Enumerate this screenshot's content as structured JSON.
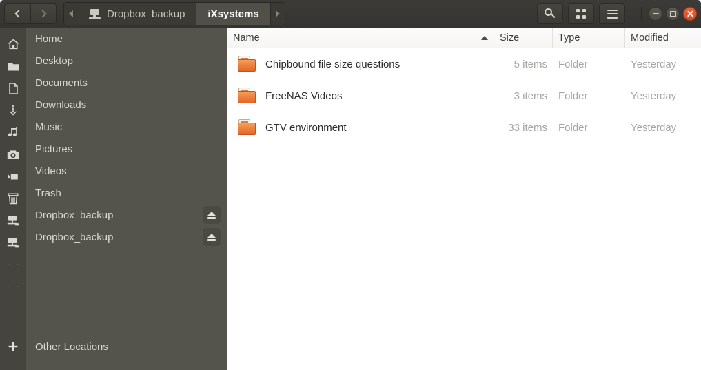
{
  "titlebar": {
    "nav": {
      "back_label": "Back",
      "forward_label": "Forward"
    },
    "tabs": [
      {
        "label": "Dropbox_backup",
        "active": false,
        "icon": "computer-icon"
      },
      {
        "label": "iXsystems",
        "active": true,
        "icon": ""
      }
    ],
    "tools": [
      {
        "name": "search-button",
        "icon": "search-icon"
      },
      {
        "name": "view-grid-button",
        "icon": "grid-icon"
      },
      {
        "name": "menu-button",
        "icon": "hamburger-icon"
      }
    ],
    "window_controls": {
      "minimize": "minimize-icon",
      "maximize": "maximize-icon",
      "close": "close-icon",
      "close_color": "#e8643a"
    }
  },
  "sidebar": {
    "items": [
      {
        "label": "Home",
        "icon": "home-icon",
        "eject": false
      },
      {
        "label": "Desktop",
        "icon": "folder-icon",
        "eject": false
      },
      {
        "label": "Documents",
        "icon": "document-icon",
        "eject": false
      },
      {
        "label": "Downloads",
        "icon": "download-icon",
        "eject": false
      },
      {
        "label": "Music",
        "icon": "music-icon",
        "eject": false
      },
      {
        "label": "Pictures",
        "icon": "camera-icon",
        "eject": false
      },
      {
        "label": "Videos",
        "icon": "video-icon",
        "eject": false
      },
      {
        "label": "Trash",
        "icon": "trash-icon",
        "eject": false
      },
      {
        "label": "Dropbox_backup",
        "icon": "network-drive-icon",
        "eject": true
      },
      {
        "label": "Dropbox_backup",
        "icon": "network-drive-icon",
        "eject": true
      }
    ],
    "other_locations": {
      "label": "Other Locations",
      "icon": "plus-icon"
    },
    "background_color": "#55544c",
    "rail_color": "#45443e"
  },
  "filelist": {
    "columns": [
      {
        "label": "Name",
        "sorted": "ascending"
      },
      {
        "label": "Size",
        "sorted": ""
      },
      {
        "label": "Type",
        "sorted": ""
      },
      {
        "label": "Modified",
        "sorted": ""
      }
    ],
    "rows": [
      {
        "name": "Chipbound file size questions",
        "size": "5 items",
        "type": "Folder",
        "modified": "Yesterday",
        "icon": "folder-icon"
      },
      {
        "name": "FreeNAS Videos",
        "size": "3 items",
        "type": "Folder",
        "modified": "Yesterday",
        "icon": "folder-icon"
      },
      {
        "name": "GTV environment",
        "size": "33 items",
        "type": "Folder",
        "modified": "Yesterday",
        "icon": "folder-icon"
      }
    ],
    "folder_color": "#ef8340"
  }
}
